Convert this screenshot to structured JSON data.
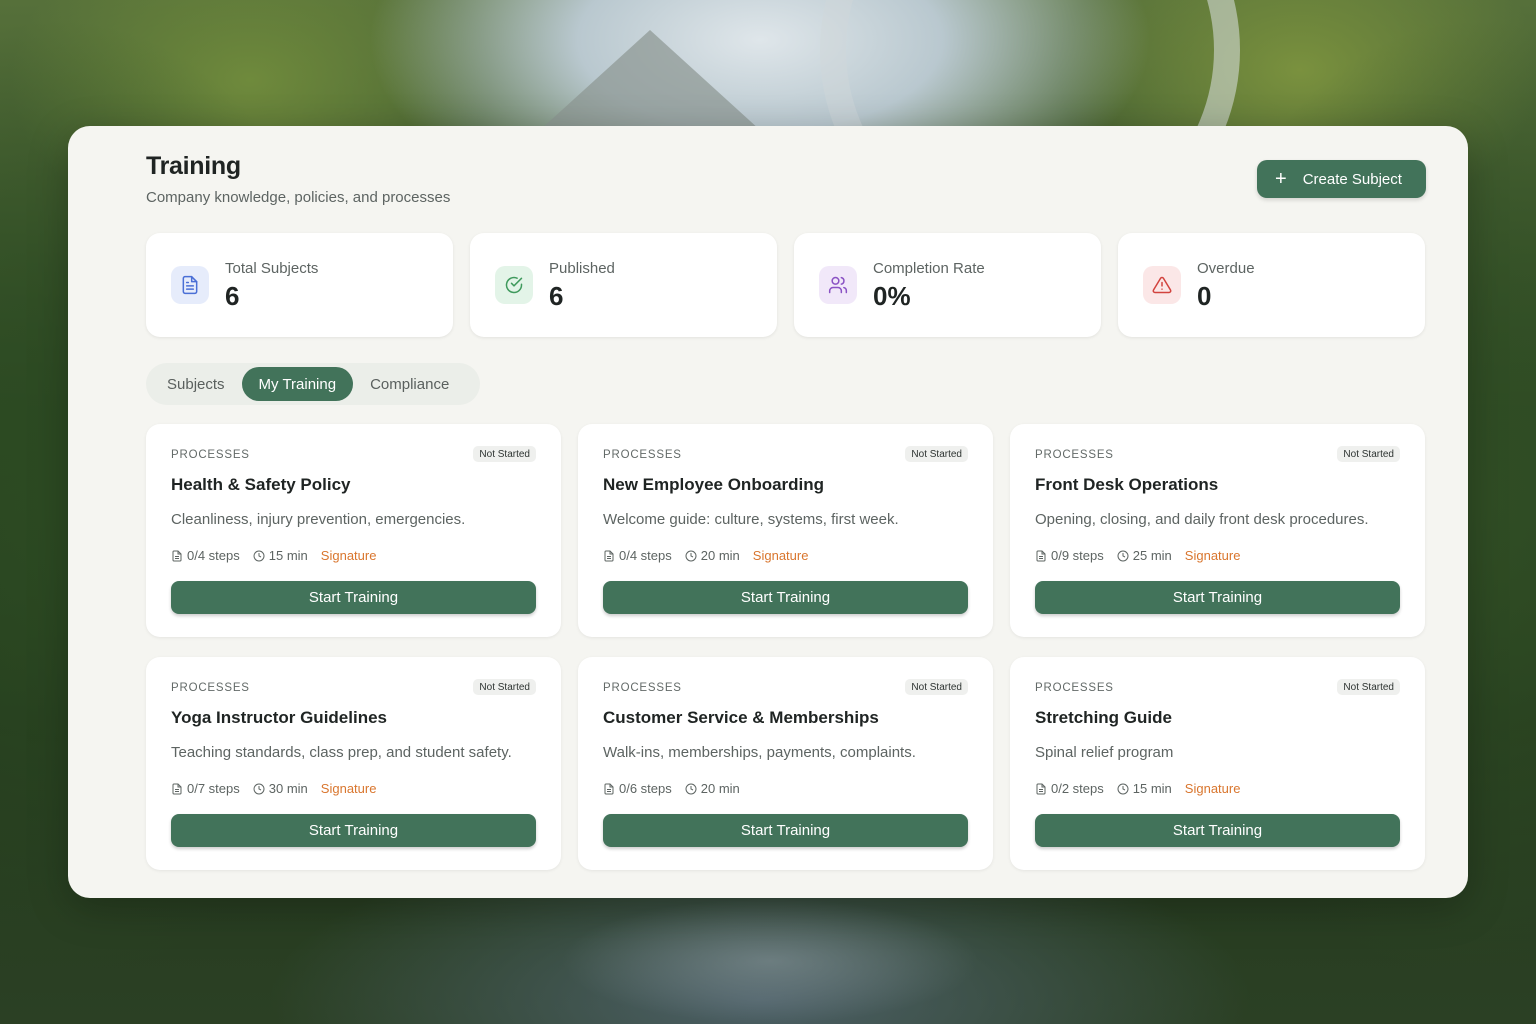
{
  "header": {
    "title": "Training",
    "subtitle": "Company knowledge, policies, and processes",
    "create_label": "Create Subject"
  },
  "stats": [
    {
      "label": "Total Subjects",
      "value": "6",
      "icon": "document-icon",
      "icon_bg": "#e6ecfb",
      "icon_color": "#4a6fd6"
    },
    {
      "label": "Published",
      "value": "6",
      "icon": "check-circle-icon",
      "icon_bg": "#e3f4e8",
      "icon_color": "#3f9a5d"
    },
    {
      "label": "Completion Rate",
      "value": "0%",
      "icon": "users-icon",
      "icon_bg": "#f1e8f9",
      "icon_color": "#8a52c4"
    },
    {
      "label": "Overdue",
      "value": "0",
      "icon": "warning-triangle-icon",
      "icon_bg": "#fbe7e7",
      "icon_color": "#d2433e"
    }
  ],
  "tabs": [
    {
      "label": "Subjects",
      "active": false
    },
    {
      "label": "My Training",
      "active": true
    },
    {
      "label": "Compliance",
      "active": false
    }
  ],
  "cards": [
    {
      "category": "PROCESSES",
      "status": "Not Started",
      "title": "Health & Safety Policy",
      "description": "Cleanliness, injury prevention, emergencies.",
      "steps": "0/4 steps",
      "duration": "15 min",
      "signature": "Signature",
      "button": "Start Training"
    },
    {
      "category": "PROCESSES",
      "status": "Not Started",
      "title": "New Employee Onboarding",
      "description": "Welcome guide: culture, systems, first week.",
      "steps": "0/4 steps",
      "duration": "20 min",
      "signature": "Signature",
      "button": "Start Training"
    },
    {
      "category": "PROCESSES",
      "status": "Not Started",
      "title": "Front Desk Operations",
      "description": "Opening, closing, and daily front desk procedures.",
      "steps": "0/9 steps",
      "duration": "25 min",
      "signature": "Signature",
      "button": "Start Training"
    },
    {
      "category": "PROCESSES",
      "status": "Not Started",
      "title": "Yoga Instructor Guidelines",
      "description": "Teaching standards, class prep, and student safety.",
      "steps": "0/7 steps",
      "duration": "30 min",
      "signature": "Signature",
      "button": "Start Training"
    },
    {
      "category": "PROCESSES",
      "status": "Not Started",
      "title": "Customer Service & Memberships",
      "description": "Walk-ins, memberships, payments, complaints.",
      "steps": "0/6 steps",
      "duration": "20 min",
      "signature": "",
      "button": "Start Training"
    },
    {
      "category": "PROCESSES",
      "status": "Not Started",
      "title": "Stretching Guide",
      "description": "Spinal relief program",
      "steps": "0/2 steps",
      "duration": "15 min",
      "signature": "Signature",
      "button": "Start Training"
    }
  ],
  "colors": {
    "accent": "#42735a",
    "signature": "#d9762e",
    "panel_bg": "#f5f5f1"
  }
}
